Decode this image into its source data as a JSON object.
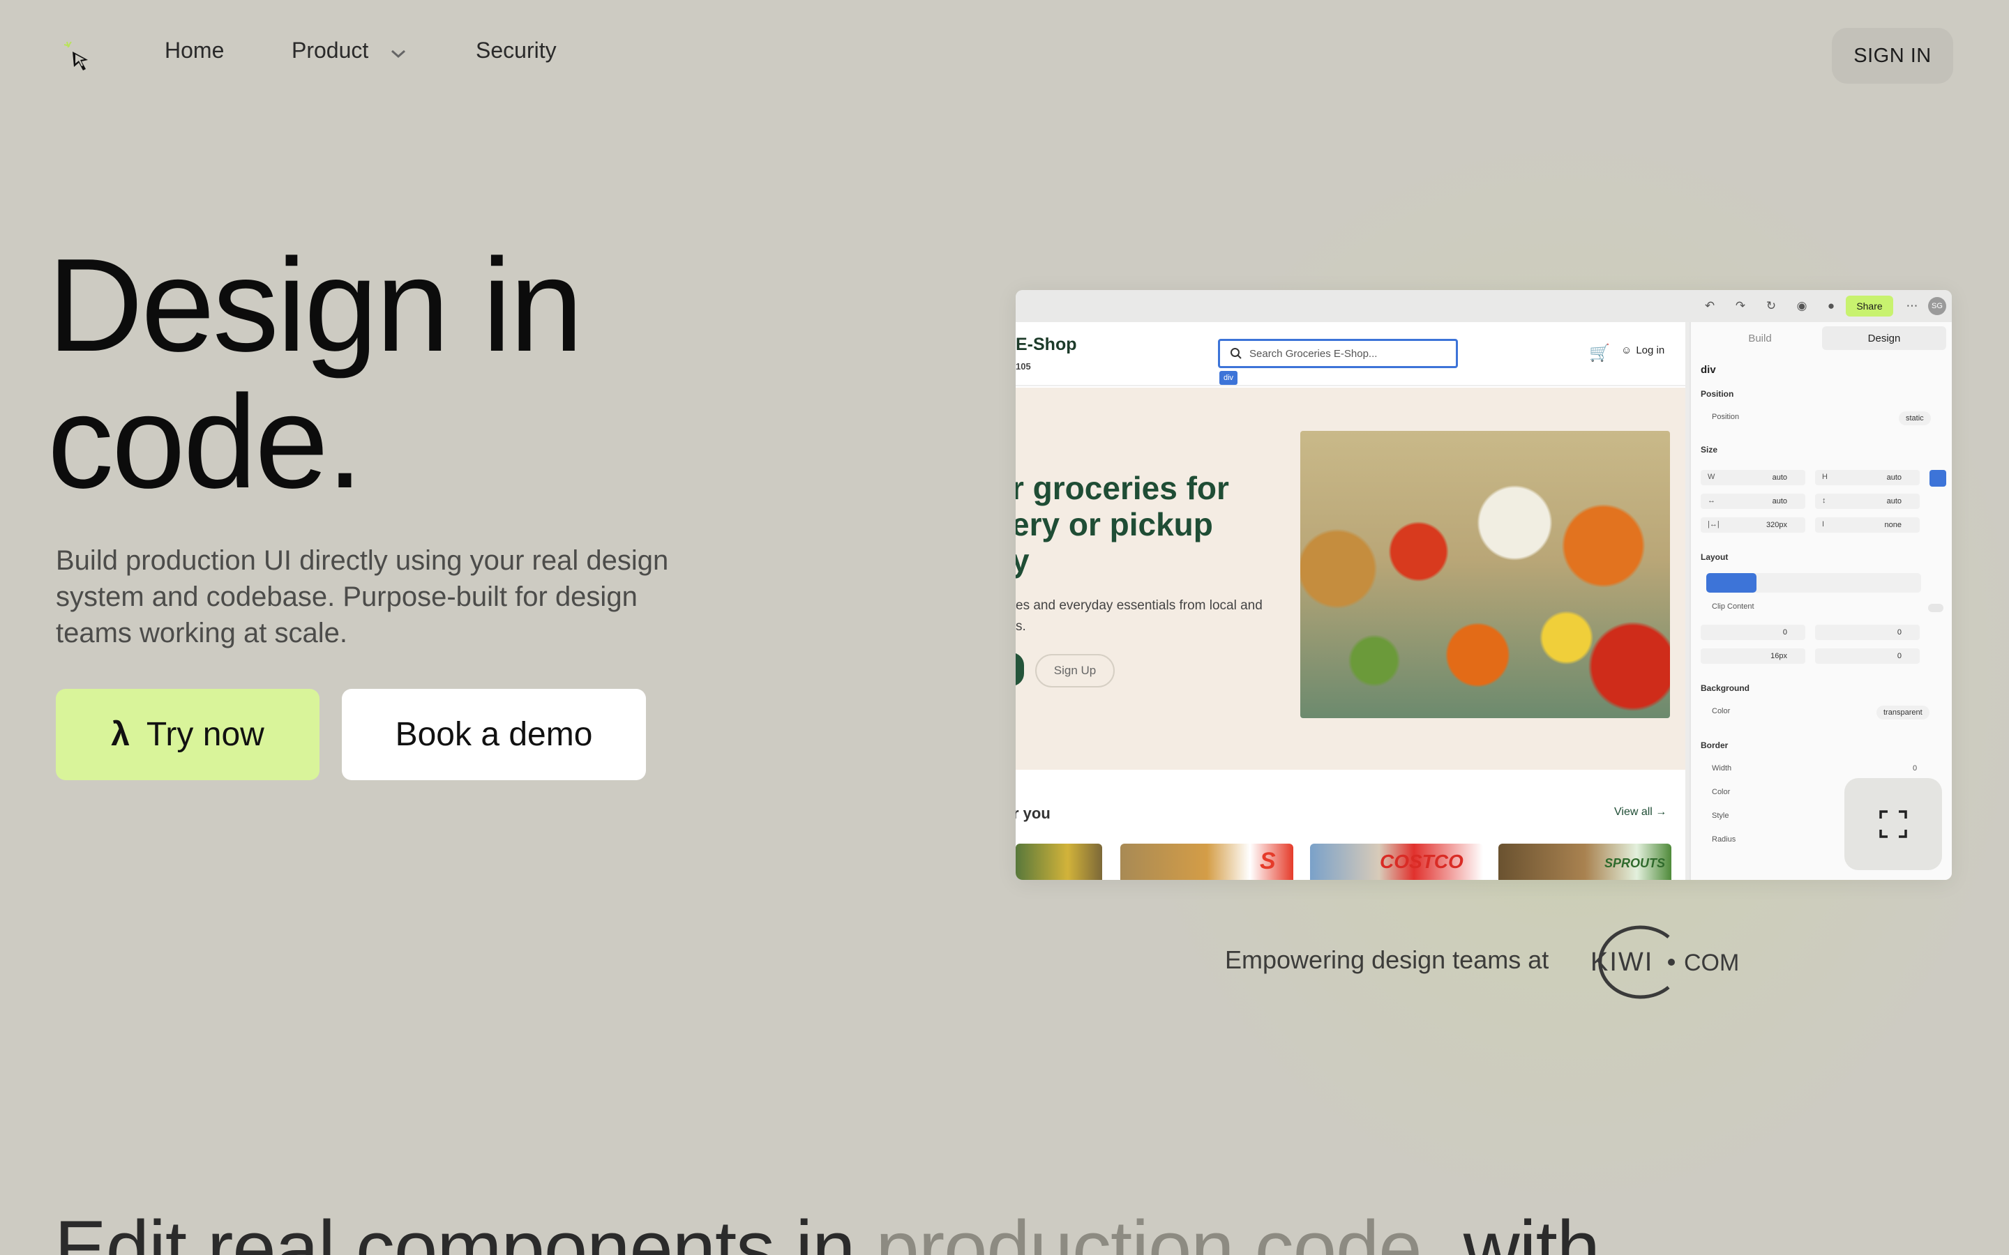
{
  "nav": {
    "logo_icon": "cursor-sparkle-icon",
    "home": "Home",
    "product": "Product",
    "security": "Security",
    "signin": "SIGN IN"
  },
  "hero": {
    "title_line1": "Design in",
    "title_line2": "code.",
    "subtitle": "Build production UI directly using your real design system and codebase. Purpose-built for design teams working at scale.",
    "try_label": "Try now",
    "try_icon": "λ",
    "demo_label": "Book a demo",
    "accent": "#d9f49a"
  },
  "preview": {
    "toolbar": {
      "share": "Share",
      "avatar": "SG",
      "icons": [
        "undo-icon",
        "redo-icon",
        "refresh-icon",
        "record-icon",
        "github-icon",
        "more-icon"
      ]
    },
    "shop": {
      "name": "E-Shop",
      "subtitle": "105",
      "search_placeholder": "Search Groceries E-Shop...",
      "selection_tag": "div",
      "login": "Log in",
      "headline": "r groceries for\nery or pickup\ny",
      "description": "es and everyday essentials from local and\ns.",
      "signup": "Sign Up",
      "section_title": "r you",
      "view_all": "View all →",
      "card_texts": [
        "",
        "S",
        "COSTCO",
        "SPROUTS"
      ]
    },
    "panel": {
      "tabs": [
        "Build",
        "Design"
      ],
      "active_tab": "Design",
      "element": "div",
      "position_section": "Position",
      "position_label": "Position",
      "position_value": "static",
      "size_section": "Size",
      "size_rows": [
        {
          "l1": "W",
          "v1": "auto",
          "l2": "H",
          "v2": "auto"
        },
        {
          "l1": "↔",
          "v1": "auto",
          "l2": "↕",
          "v2": "auto"
        },
        {
          "l1": "|↔|",
          "v1": "320px",
          "l2": "I",
          "v2": "none"
        }
      ],
      "layout_section": "Layout",
      "clip_content": "Clip Content",
      "layout_rows": [
        {
          "v1": "0",
          "v2": "0"
        },
        {
          "v1": "16px",
          "v2": "0"
        }
      ],
      "background_section": "Background",
      "color_label": "Color",
      "color_value": "transparent",
      "border_section": "Border",
      "border_width": "Width",
      "border_width_value": "0",
      "border_color": "Color",
      "border_style": "Style",
      "border_radius": "Radius"
    }
  },
  "trust": {
    "label": "Empowering design teams at",
    "logo_text_1": "KIWI",
    "logo_text_2": "COM"
  },
  "bottom": {
    "title_a": "Edit real components in ",
    "title_b": "production code",
    "title_c": ", with"
  }
}
